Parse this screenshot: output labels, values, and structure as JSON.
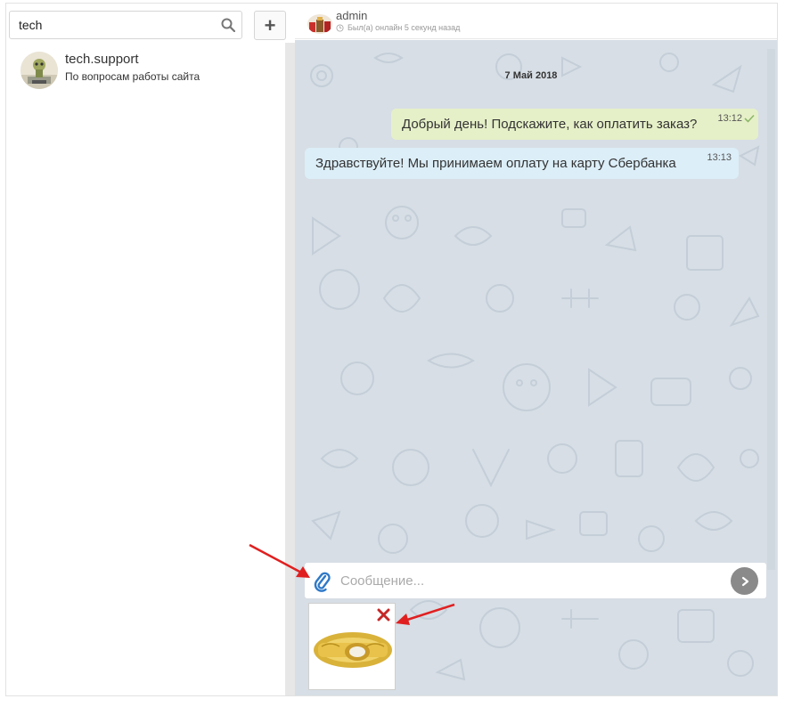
{
  "search": {
    "value": "tech"
  },
  "contacts": [
    {
      "name": "tech.support",
      "description": "По вопросам работы сайта"
    }
  ],
  "chat": {
    "contact_name": "admin",
    "status": "Был(а) онлайн 5 секунд назад",
    "date": "7 Май 2018",
    "messages": [
      {
        "direction": "out",
        "text": "Добрый день! Подскажите, как оплатить заказ?",
        "time": "13:12",
        "read": true
      },
      {
        "direction": "in",
        "text": "Здравствуйте! Мы принимаем оплату на карту Сбербанка",
        "time": "13:13"
      }
    ]
  },
  "composer": {
    "placeholder": "Сообщение..."
  },
  "colors": {
    "outgoing_bubble": "#e6f0c8",
    "incoming_bubble": "#dceef8",
    "chat_background": "#d7dee5",
    "annotation_arrow": "#e02020",
    "attach_icon": "#2f79c8"
  },
  "icons": [
    "search-icon",
    "plus-icon",
    "clock-icon",
    "check-icon",
    "paperclip-icon",
    "send-arrow-icon",
    "remove-x-icon"
  ]
}
